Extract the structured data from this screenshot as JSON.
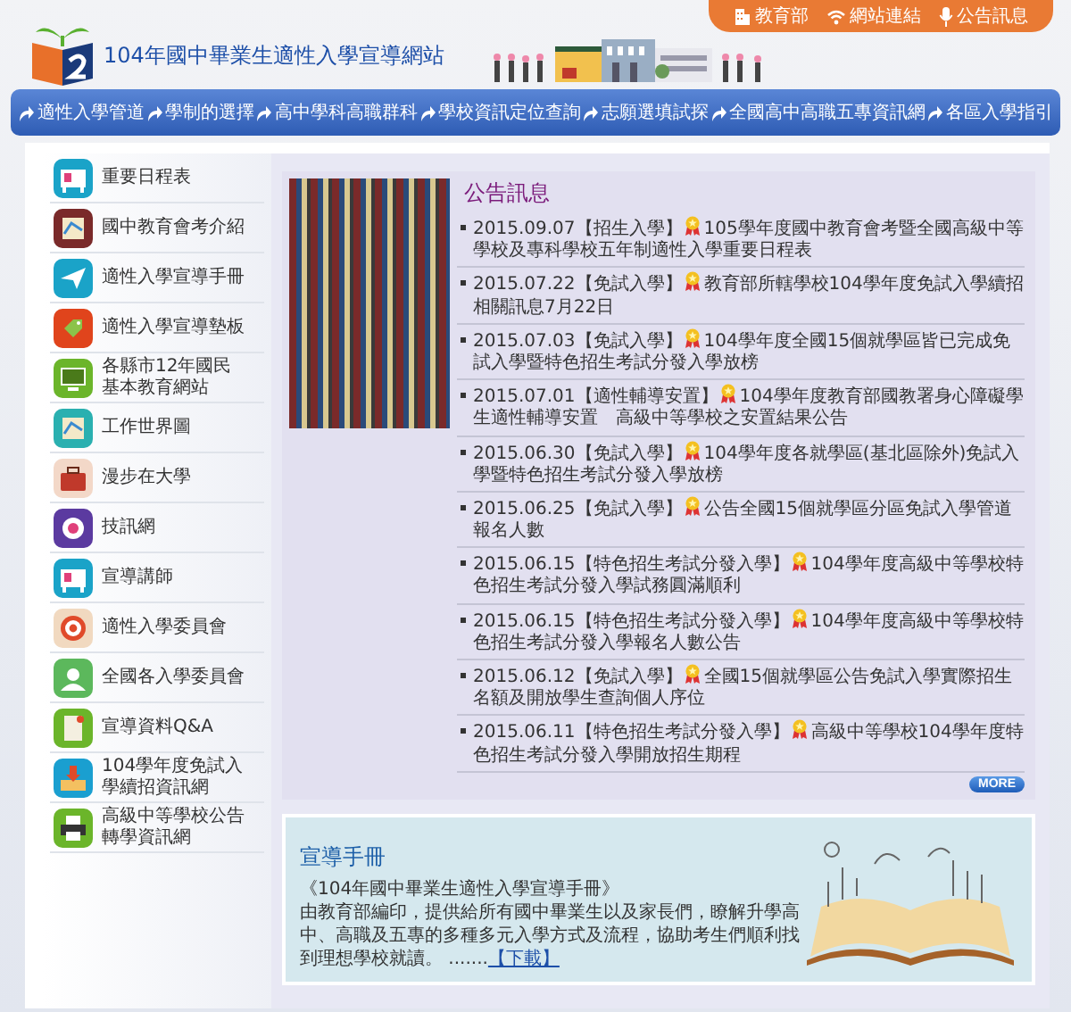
{
  "site_title": "104年國中畢業生適性入學宣導網站",
  "top_links": [
    {
      "kind": "building",
      "label": "教育部"
    },
    {
      "kind": "wifi",
      "label": "網站連結"
    },
    {
      "kind": "mic",
      "label": "公告訊息"
    }
  ],
  "nav": [
    "適性入學管道",
    "學制的選擇",
    "高中學科高職群科",
    "學校資訊定位查詢",
    "志願選填試探",
    "全國高中高職五專資訊網",
    "各區入學指引"
  ],
  "sidebar": {
    "items": [
      {
        "label": "重要日程表",
        "kind": "board",
        "color": "#1aa3c8"
      },
      {
        "label": "國中教育會考介紹",
        "kind": "map",
        "color": "#7a2a2a"
      },
      {
        "label": "適性入學宣導手冊",
        "kind": "plane",
        "color": "#1aa3c8"
      },
      {
        "label": "適性入學宣導墊板",
        "kind": "tag",
        "color": "#e0441c"
      },
      {
        "label": "各縣市12年國民基本教育網站",
        "kind": "monitor",
        "color": "#6bb52a"
      },
      {
        "label": "工作世界圖",
        "kind": "map",
        "color": "#2ab0b0"
      },
      {
        "label": "漫步在大學",
        "kind": "bag",
        "color": "#f3d8c8"
      },
      {
        "label": "技訊網",
        "kind": "gear",
        "color": "#5b3aa0"
      },
      {
        "label": "宣導講師",
        "kind": "board",
        "color": "#1aa3c8"
      },
      {
        "label": "適性入學委員會",
        "kind": "target",
        "color": "#f1d9c0"
      },
      {
        "label": "全國各入學委員會",
        "kind": "person",
        "color": "#5cb85c"
      },
      {
        "label": "宣導資料Q&A",
        "kind": "note",
        "color": "#6bb52a"
      },
      {
        "label": "104學年度免試入學續招資訊網",
        "kind": "download",
        "color": "#1a9fd0"
      },
      {
        "label": "高級中等學校公告轉學資訊網",
        "kind": "printer",
        "color": "#6bb52a"
      }
    ]
  },
  "news": {
    "title": "公告訊息",
    "more": "MORE",
    "items": [
      {
        "date": "2015.09.07",
        "category": "【招生入學】",
        "text": "105學年度國中教育會考暨全國高級中等學校及專科學校五年制適性入學重要日程表"
      },
      {
        "date": "2015.07.22",
        "category": "【免試入學】",
        "text": "教育部所轄學校104學年度免試入學續招相關訊息7月22日"
      },
      {
        "date": "2015.07.03",
        "category": "【免試入學】",
        "text": "104學年度全國15個就學區皆已完成免試入學暨特色招生考試分發入學放榜"
      },
      {
        "date": "2015.07.01",
        "category": "【適性輔導安置】",
        "text": "104學年度教育部國教署身心障礙學生適性輔導安置　高級中等學校之安置結果公告"
      },
      {
        "date": "2015.06.30",
        "category": "【免試入學】",
        "text": "104學年度各就學區(基北區除外)免試入學暨特色招生考試分發入學放榜"
      },
      {
        "date": "2015.06.25",
        "category": "【免試入學】",
        "text": "公告全國15個就學區分區免試入學管道報名人數"
      },
      {
        "date": "2015.06.15",
        "category": "【特色招生考試分發入學】",
        "text": "104學年度高級中等學校特色招生考試分發入學試務圓滿順利"
      },
      {
        "date": "2015.06.15",
        "category": "【特色招生考試分發入學】",
        "text": "104學年度高級中等學校特色招生考試分發入學報名人數公告"
      },
      {
        "date": "2015.06.12",
        "category": "【免試入學】",
        "text": "全國15個就學區公告免試入學實際招生名額及開放學生查詢個人序位"
      },
      {
        "date": "2015.06.11",
        "category": "【特色招生考試分發入學】",
        "text": "高級中等學校104學年度特色招生考試分發入學開放招生期程"
      }
    ]
  },
  "handbook": {
    "title": "宣導手冊",
    "subtitle": "《104年國中畢業生適性入學宣導手冊》",
    "body": "由教育部編印，提供給所有國中畢業生以及家長們，瞭解升學高中、高職及五專的多種多元入學方式及流程，協助考生們順利找到理想學校就讀。 .......",
    "link": "【下載】"
  }
}
